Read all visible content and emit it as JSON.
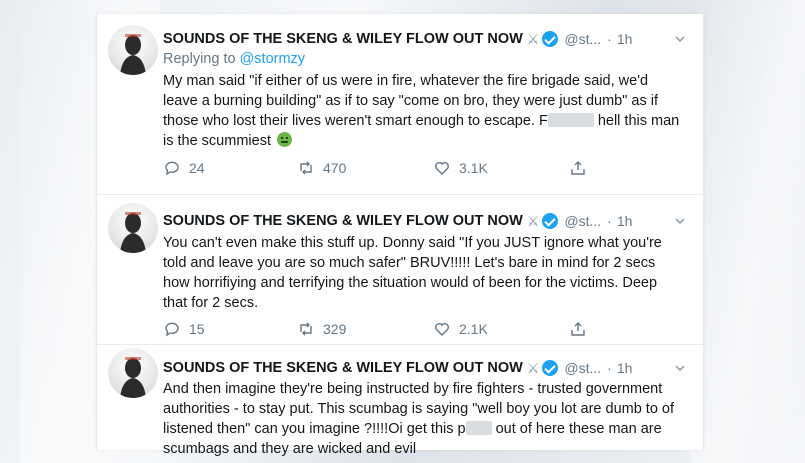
{
  "tweets": [
    {
      "display_name": "SOUNDS OF THE SKENG & WILEY FLOW OUT NOW",
      "handle": "@st...",
      "separator": "·",
      "time": "1h",
      "reply_prefix": "Replying to ",
      "reply_handle": "@stormzy",
      "text_part1": "My man said \"if either of us were in fire, whatever the fire brigade said, we'd leave a burning building\" as if to say \"come on bro, they were just dumb\" as if those who lost their lives weren't smart enough to escape. F",
      "text_part2": " hell this man is the scummiest",
      "replies": "24",
      "retweets": "470",
      "likes": "3.1K"
    },
    {
      "display_name": "SOUNDS OF THE SKENG & WILEY FLOW OUT NOW",
      "handle": "@st...",
      "separator": "·",
      "time": "1h",
      "text": "You can't even make this stuff up. Donny said \"If you JUST ignore what you're told and leave you are so much safer\" BRUV!!!!! Let's bare in mind for 2 secs how horrifiying and terrifying the situation would of been for the victims. Deep that for 2 secs.",
      "replies": "15",
      "retweets": "329",
      "likes": "2.1K"
    },
    {
      "display_name": "SOUNDS OF THE SKENG & WILEY FLOW OUT NOW",
      "handle": "@st...",
      "separator": "·",
      "time": "1h",
      "text_part1": "And then imagine they're being instructed by fire fighters - trusted government authorities - to stay put. This scumbag is saying \"well boy you lot are dumb to of listened then\" can you imagine ?!!!!Oi get this p",
      "text_part2": " out of here these man are scumbags and they are wicked and evil"
    }
  ],
  "icons": {
    "swords": "crossed-swords-icon",
    "verified": "verified-badge-icon",
    "caret": "chevron-down-icon",
    "reply": "reply-icon",
    "retweet": "retweet-icon",
    "like": "heart-icon",
    "share": "share-icon",
    "sick": "nauseated-face-emoji"
  },
  "colors": {
    "link": "#1da1f2",
    "muted": "#657786",
    "text": "#14171a",
    "verified": "#1da1f2"
  }
}
